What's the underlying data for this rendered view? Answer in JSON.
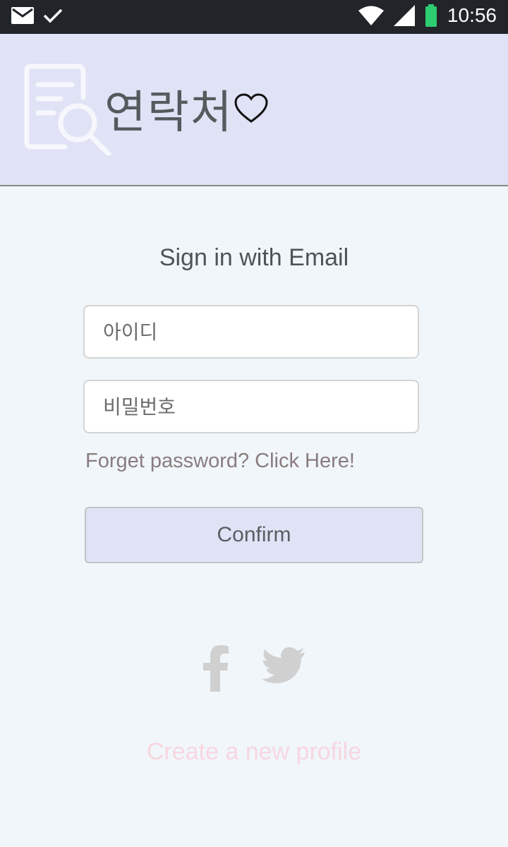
{
  "status_bar": {
    "time": "10:56",
    "left_icons": [
      "mail-icon",
      "check-icon"
    ],
    "right_icons": [
      "wifi-icon",
      "signal-icon",
      "battery-icon"
    ],
    "battery_color": "#2ecc71"
  },
  "header": {
    "title": "연락처",
    "logo_icon": "document-search-icon",
    "heart_icon": "heart-outline-icon",
    "background": "#e0e3f6"
  },
  "signin": {
    "title": "Sign in with Email",
    "id_placeholder": "아이디",
    "password_placeholder": "비밀번호",
    "forgot_link": "Forget password? Click Here!",
    "confirm_label": "Confirm"
  },
  "social": {
    "icons": [
      "facebook-icon",
      "twitter-icon"
    ]
  },
  "footer": {
    "create_profile": "Create a new profile",
    "link_color": "#f8d6e0"
  }
}
